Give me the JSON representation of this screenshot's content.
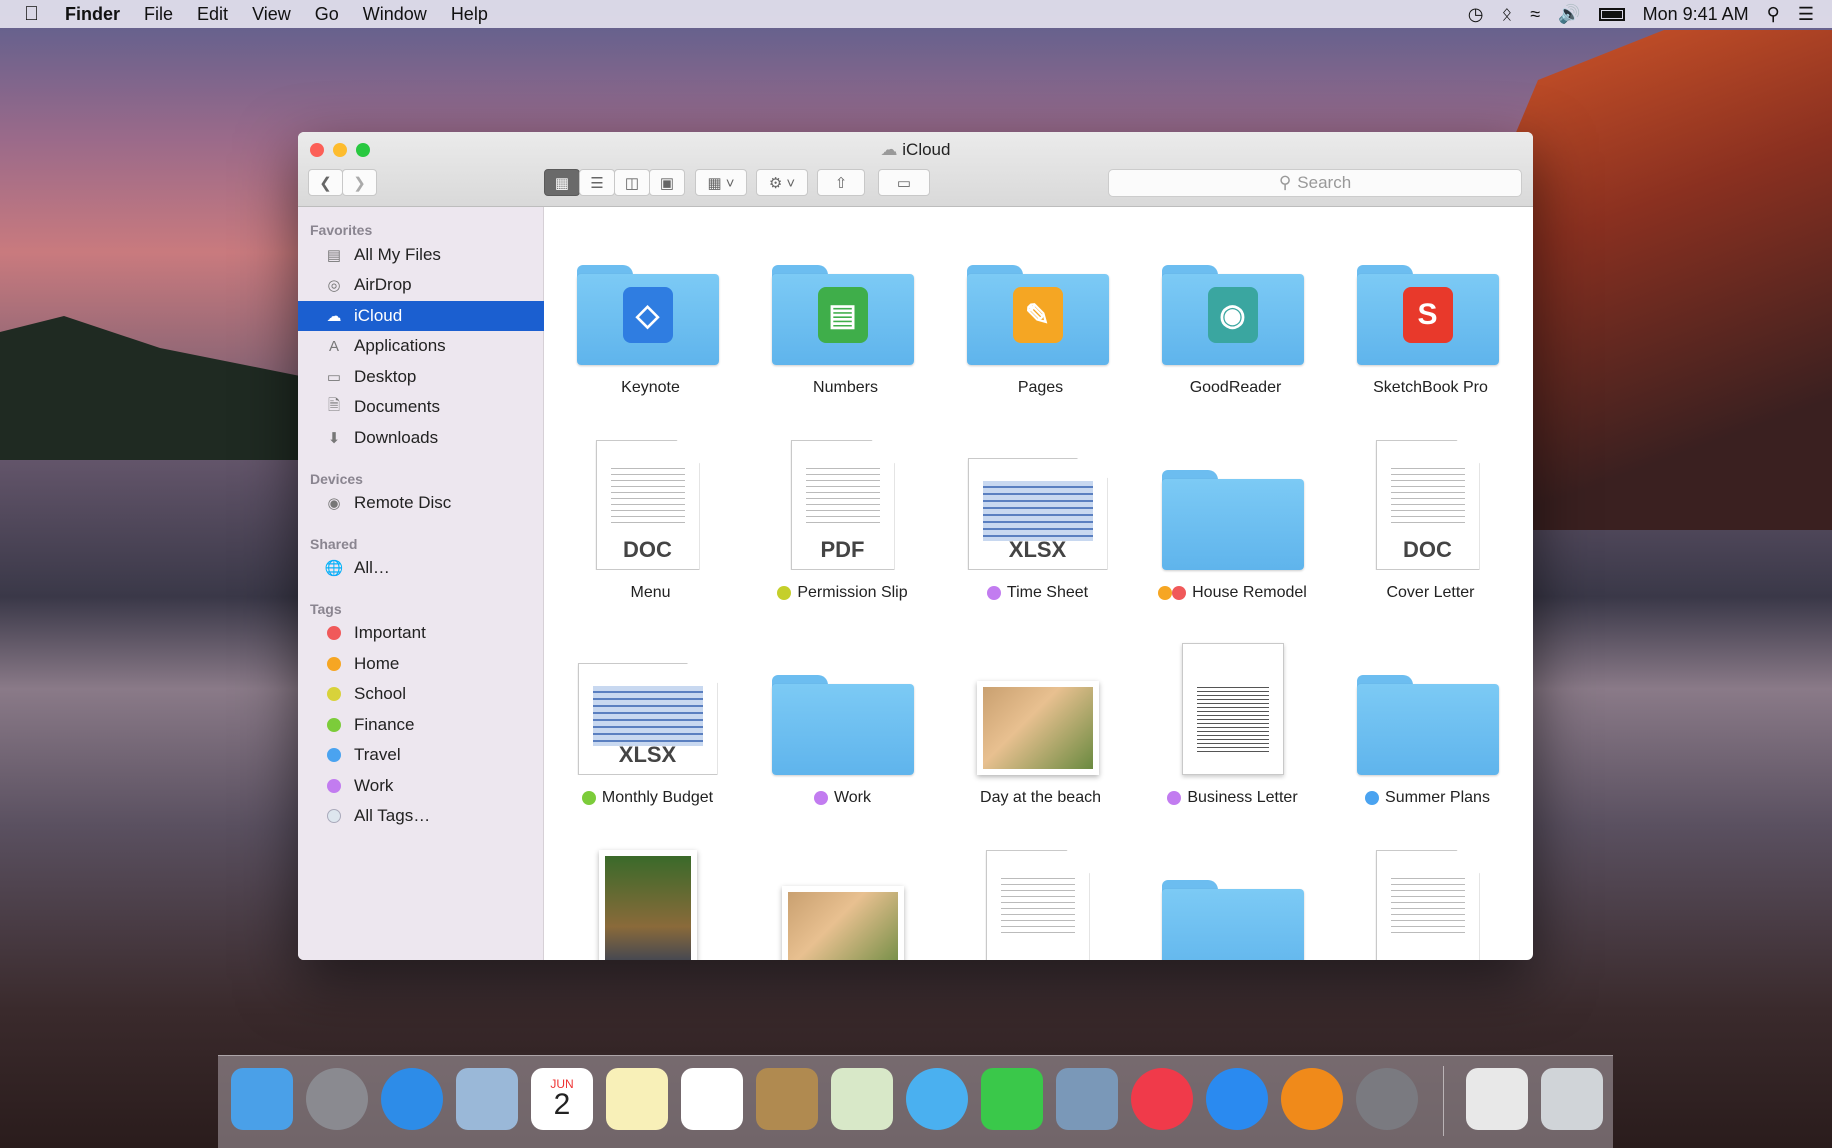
{
  "menubar": {
    "app": "Finder",
    "items": [
      "File",
      "Edit",
      "View",
      "Go",
      "Window",
      "Help"
    ],
    "clock": "Mon 9:41 AM",
    "status_icons": [
      "time-machine-icon",
      "bluetooth-icon",
      "wifi-icon",
      "volume-icon",
      "battery-icon",
      "spotlight-icon",
      "notification-center-icon"
    ]
  },
  "window": {
    "title": "iCloud",
    "search_placeholder": "Search",
    "traffic_colors": [
      "#fc5f57",
      "#fdbc2e",
      "#29c840"
    ]
  },
  "sidebar": {
    "favorites_header": "Favorites",
    "favorites": [
      {
        "label": "All My Files",
        "icon": "all-files-icon"
      },
      {
        "label": "AirDrop",
        "icon": "airdrop-icon"
      },
      {
        "label": "iCloud",
        "icon": "cloud-icon",
        "selected": true
      },
      {
        "label": "Applications",
        "icon": "applications-icon"
      },
      {
        "label": "Desktop",
        "icon": "desktop-icon"
      },
      {
        "label": "Documents",
        "icon": "documents-icon"
      },
      {
        "label": "Downloads",
        "icon": "downloads-icon"
      }
    ],
    "devices_header": "Devices",
    "devices": [
      {
        "label": "Remote Disc"
      }
    ],
    "shared_header": "Shared",
    "shared": [
      {
        "label": "All…"
      }
    ],
    "tags_header": "Tags",
    "tags": [
      {
        "label": "Important",
        "color": "#f0595a"
      },
      {
        "label": "Home",
        "color": "#f6a623"
      },
      {
        "label": "School",
        "color": "#d8d23a"
      },
      {
        "label": "Finance",
        "color": "#7ccc3a"
      },
      {
        "label": "Travel",
        "color": "#4aa3f0"
      },
      {
        "label": "Work",
        "color": "#c27cf0"
      },
      {
        "label": "All Tags…",
        "color": "#dde6ee"
      }
    ]
  },
  "files": [
    {
      "name": "Keynote",
      "kind": "folder",
      "emblem": "keynote-icon",
      "tags": []
    },
    {
      "name": "Numbers",
      "kind": "folder",
      "emblem": "numbers-icon",
      "tags": []
    },
    {
      "name": "Pages",
      "kind": "folder",
      "emblem": "pages-icon",
      "tags": []
    },
    {
      "name": "GoodReader",
      "kind": "folder",
      "emblem": "goodreader-icon",
      "tags": []
    },
    {
      "name": "SketchBook Pro",
      "kind": "folder",
      "emblem": "sketchbook-icon",
      "tags": []
    },
    {
      "name": "Menu",
      "kind": "doc",
      "ext": "DOC",
      "tags": []
    },
    {
      "name": "Permission Slip",
      "kind": "doc",
      "ext": "PDF",
      "tags": [
        "#c5cf2a"
      ]
    },
    {
      "name": "Time Sheet",
      "kind": "sheet",
      "ext": "XLSX",
      "tags": [
        "#c27cf0"
      ]
    },
    {
      "name": "House Remodel",
      "kind": "folder",
      "tags": [
        "#f6a623",
        "#f0595a"
      ]
    },
    {
      "name": "Cover Letter",
      "kind": "doc",
      "ext": "DOC",
      "tags": []
    },
    {
      "name": "Monthly Budget",
      "kind": "sheet",
      "ext": "XLSX",
      "tags": [
        "#7ccc3a"
      ]
    },
    {
      "name": "Work",
      "kind": "folder",
      "tags": [
        "#c27cf0"
      ]
    },
    {
      "name": "Day at the beach",
      "kind": "photo",
      "tags": []
    },
    {
      "name": "Business Letter",
      "kind": "letter",
      "tags": [
        "#c27cf0"
      ]
    },
    {
      "name": "Summer Plans",
      "kind": "folder",
      "tags": [
        "#4aa3f0"
      ]
    },
    {
      "name": "",
      "kind": "photo-tall",
      "tags": []
    },
    {
      "name": "",
      "kind": "photo",
      "tags": []
    },
    {
      "name": "",
      "kind": "doc",
      "ext": "",
      "tags": []
    },
    {
      "name": "",
      "kind": "folder",
      "tags": []
    },
    {
      "name": "",
      "kind": "doc",
      "ext": "",
      "tags": []
    }
  ],
  "dock": [
    "finder-icon",
    "launchpad-icon",
    "safari-icon",
    "mail-icon",
    "calendar-icon",
    "notes-icon",
    "reminders-icon",
    "contacts-icon",
    "maps-icon",
    "messages-icon",
    "facetime-icon",
    "photo-booth-icon",
    "itunes-icon",
    "app-store-icon",
    "ibooks-icon",
    "system-preferences-icon",
    "preview-icon",
    "trash-icon"
  ],
  "calendar": {
    "month": "JUN",
    "day": "2"
  }
}
